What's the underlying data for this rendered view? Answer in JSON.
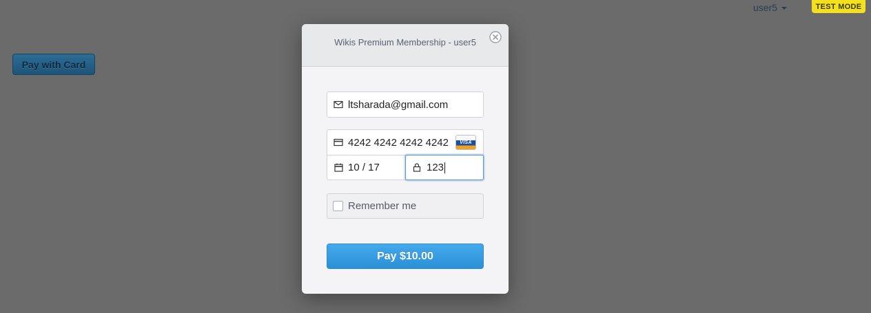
{
  "page": {
    "user_menu_label": "user5",
    "test_mode_badge": "TEST MODE",
    "pay_with_card_label": "Pay with Card"
  },
  "modal": {
    "title": "Wikis Premium Membership - user5",
    "email_value": "ltsharada@gmail.com",
    "card_number_value": "4242 4242 4242 4242",
    "card_brand": "VISA",
    "expiry_value": "10 / 17",
    "cvc_value": "123",
    "remember_label": "Remember me",
    "remember_checked": false,
    "pay_button_label": "Pay $10.00"
  },
  "icons": {
    "close": "close-icon",
    "email": "mail-icon",
    "card": "credit-card-icon",
    "expiry": "calendar-icon",
    "cvc": "lock-icon",
    "user_menu": "chevron-down-icon"
  },
  "colors": {
    "overlay_bg": "#6b6b6b",
    "test_mode_bg": "#f5e01d",
    "pay_button_bg": "#3aa0e4",
    "focus_border": "#4f8fd6"
  }
}
